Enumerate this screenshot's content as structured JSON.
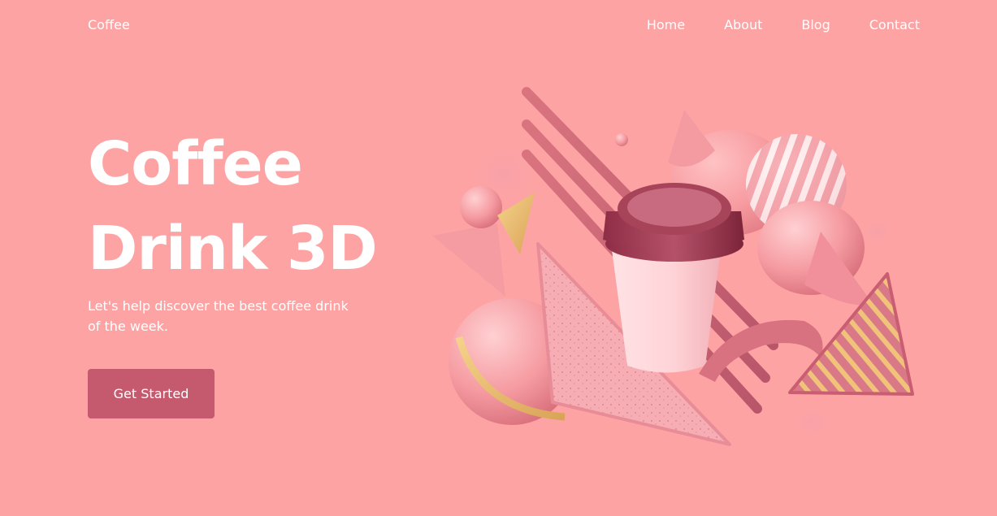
{
  "nav": {
    "logo": "Coffee",
    "links": [
      {
        "label": "Home"
      },
      {
        "label": "About"
      },
      {
        "label": "Blog"
      },
      {
        "label": "Contact"
      }
    ]
  },
  "hero": {
    "title_line1": "Coffee",
    "title_line2": "Drink 3D",
    "subtitle": "Let's help discover the best coffee drink of the week.",
    "cta_label": "Get Started"
  },
  "colors": {
    "background": "#fea3a4",
    "button": "#c55a6f",
    "text": "#ffffff"
  }
}
